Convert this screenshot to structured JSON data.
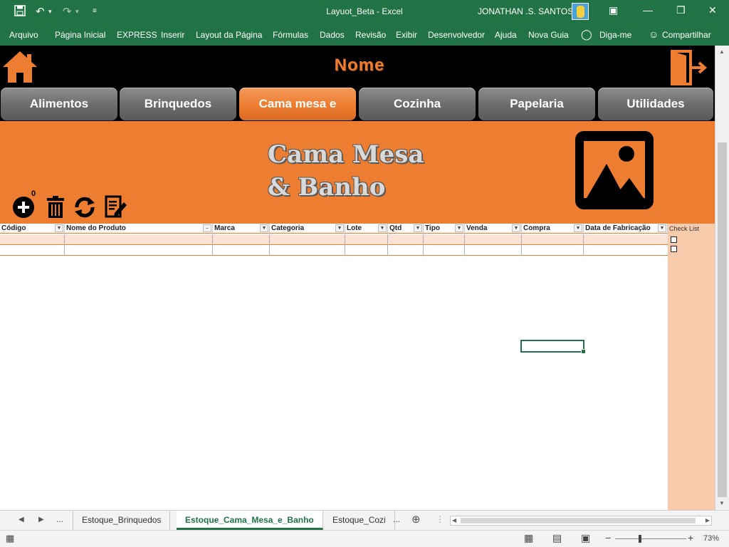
{
  "window": {
    "title": "Layuot_Beta  -  Excel",
    "user": "JONATHAN .S. SANTOS"
  },
  "ribbon": {
    "tabs": [
      "Arquivo",
      "Página Inicial",
      "EXPRESS",
      "Inserir",
      "Layout da Página",
      "Fórmulas",
      "Dados",
      "Revisão",
      "Exibir",
      "Desenvolvedor",
      "Ajuda",
      "Nova Guia"
    ],
    "tell_me": "Diga-me",
    "share": "Compartilhar"
  },
  "header": {
    "nome": "Nome"
  },
  "nav": {
    "buttons": [
      "Alimentos",
      "Brinquedos",
      "Cama mesa e",
      "Cozinha",
      "Papelaria",
      "Utilidades"
    ],
    "active_index": 2
  },
  "section": {
    "title_line1": "Cama Mesa",
    "title_line2": "& Banho",
    "counter": "0"
  },
  "table": {
    "columns": [
      "Código",
      "Nome do Produto",
      "Marca",
      "Categoria",
      "Lote",
      "Qtd",
      "Tipo",
      "Venda",
      "Compra",
      "Data de Fabricação"
    ],
    "check_label": "Check List"
  },
  "sheet_tabs": {
    "nav_more": "...",
    "tabs": [
      "Estoque_Brinquedos",
      "Estoque_Cama_Mesa_e_Banho",
      "Estoque_Cozi"
    ],
    "active_index": 1,
    "overflow": "..."
  },
  "status": {
    "zoom": "73%"
  },
  "colors": {
    "excel_green": "#217346",
    "accent_orange": "#ed7d31",
    "light_orange": "#fbe4d5",
    "check_col": "#f8cbad"
  },
  "icons": [
    "save-icon",
    "undo-icon",
    "redo-icon",
    "customize-icon",
    "ribbon-display-icon",
    "minimize-icon",
    "restore-icon",
    "close-icon",
    "lightbulb-icon",
    "share-icon",
    "home-icon",
    "exit-icon",
    "add-icon",
    "trash-icon",
    "refresh-icon",
    "edit-icon",
    "image-placeholder-icon"
  ]
}
